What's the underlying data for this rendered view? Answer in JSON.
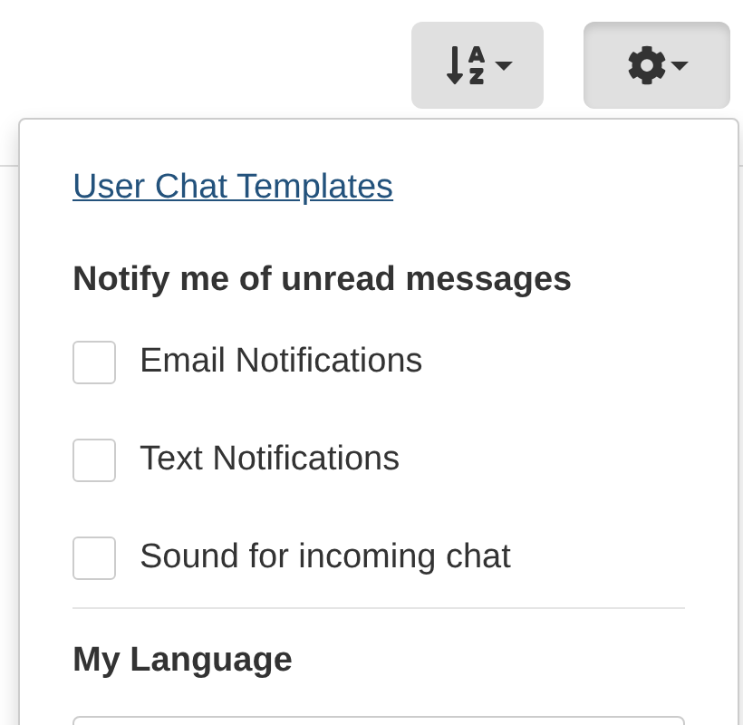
{
  "menu": {
    "link": "User Chat Templates",
    "notify_heading": "Notify me of unread messages",
    "options": [
      {
        "label": "Email Notifications",
        "checked": false
      },
      {
        "label": "Text Notifications",
        "checked": false
      },
      {
        "label": "Sound for incoming chat",
        "checked": false
      }
    ],
    "language_heading": "My Language"
  },
  "toolbar": {
    "settings_open": true
  }
}
